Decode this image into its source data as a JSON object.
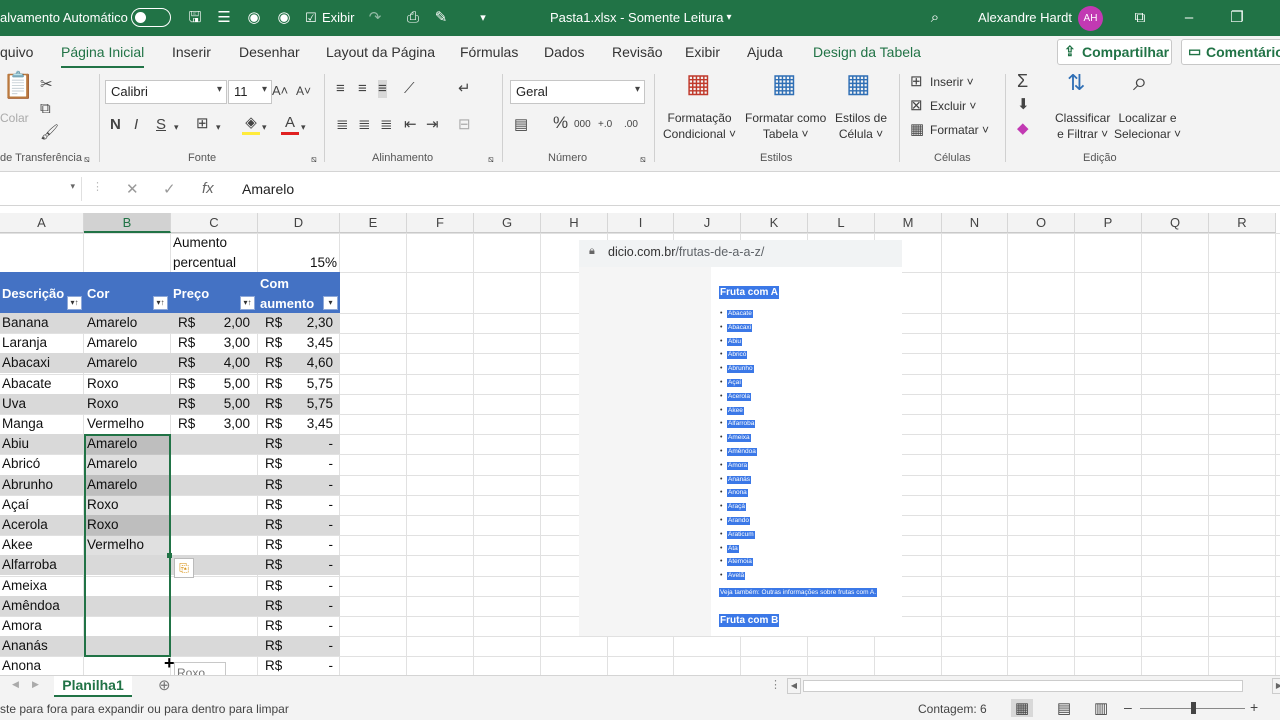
{
  "titlebar": {
    "autosave_label": "alvamento Automático",
    "view_label": "Exibir",
    "document_title": "Pasta1.xlsx  -  Somente Leitura",
    "user_name": "Alexandre Hardt",
    "user_initials": "AH"
  },
  "tabs": [
    "quivo",
    "Página Inicial",
    "Inserir",
    "Desenhar",
    "Layout da Página",
    "Fórmulas",
    "Dados",
    "Revisão",
    "Exibir",
    "Ajuda",
    "Design da Tabela"
  ],
  "share_label": "Compartilhar",
  "comments_label": "Comentário",
  "ribbon": {
    "paste_label": "Colar",
    "clipboard_group": "de Transferência",
    "font_name": "Calibri",
    "font_size": "11",
    "bold": "N",
    "italic": "I",
    "underline": "S",
    "font_group": "Fonte",
    "align_group": "Alinhamento",
    "number_format": "Geral",
    "number_group": "Número",
    "cond_format": [
      "Formatação",
      "Condicional ˅"
    ],
    "format_table": [
      "Formatar como",
      "Tabela ˅"
    ],
    "cell_styles": [
      "Estilos de",
      "Célula ˅"
    ],
    "styles_group": "Estilos",
    "insert_label": "Inserir",
    "delete_label": "Excluir",
    "format_label": "Formatar",
    "cells_group": "Células",
    "sort_label": [
      "Classificar",
      "e Filtrar ˅"
    ],
    "find_label": [
      "Localizar e",
      "Selecionar ˅"
    ],
    "edit_group": "Edição"
  },
  "formula_bar": {
    "content": "Amarelo"
  },
  "columns": [
    "A",
    "B",
    "C",
    "D",
    "E",
    "F",
    "G",
    "H",
    "I",
    "J",
    "K",
    "L",
    "M",
    "N",
    "O",
    "P",
    "Q",
    "R"
  ],
  "sheet": {
    "c1_line1": "Aumento",
    "c1_line2": "percentual",
    "d1": "15%",
    "headers": [
      "Descrição",
      "Cor",
      "Preço",
      "Com",
      "aumento"
    ],
    "rows": [
      {
        "desc": "Banana",
        "cor": "Amarelo",
        "cur1": "R$",
        "preco": "2,00",
        "cur2": "R$",
        "aumento": "2,30"
      },
      {
        "desc": "Laranja",
        "cor": "Amarelo",
        "cur1": "R$",
        "preco": "3,00",
        "cur2": "R$",
        "aumento": "3,45"
      },
      {
        "desc": "Abacaxi",
        "cor": "Amarelo",
        "cur1": "R$",
        "preco": "4,00",
        "cur2": "R$",
        "aumento": "4,60"
      },
      {
        "desc": "Abacate",
        "cor": "Roxo",
        "cur1": "R$",
        "preco": "5,00",
        "cur2": "R$",
        "aumento": "5,75"
      },
      {
        "desc": "Uva",
        "cor": "Roxo",
        "cur1": "R$",
        "preco": "5,00",
        "cur2": "R$",
        "aumento": "5,75"
      },
      {
        "desc": "Manga",
        "cor": "Vermelho",
        "cur1": "R$",
        "preco": "3,00",
        "cur2": "R$",
        "aumento": "3,45"
      },
      {
        "desc": "Abiu",
        "cor": "Amarelo",
        "cur1": "",
        "preco": "",
        "cur2": "R$",
        "aumento": "-"
      },
      {
        "desc": "Abricó",
        "cor": "Amarelo",
        "cur1": "",
        "preco": "",
        "cur2": "R$",
        "aumento": "-"
      },
      {
        "desc": "Abrunho",
        "cor": "Amarelo",
        "cur1": "",
        "preco": "",
        "cur2": "R$",
        "aumento": "-"
      },
      {
        "desc": "Açaí",
        "cor": "Roxo",
        "cur1": "",
        "preco": "",
        "cur2": "R$",
        "aumento": "-"
      },
      {
        "desc": "Acerola",
        "cor": "Roxo",
        "cur1": "",
        "preco": "",
        "cur2": "R$",
        "aumento": "-"
      },
      {
        "desc": "Akee",
        "cor": "Vermelho",
        "cur1": "",
        "preco": "",
        "cur2": "R$",
        "aumento": "-"
      },
      {
        "desc": "Alfarroba",
        "cor": "",
        "cur1": "",
        "preco": "",
        "cur2": "R$",
        "aumento": "-"
      },
      {
        "desc": "Ameixa",
        "cor": "",
        "cur1": "",
        "preco": "",
        "cur2": "R$",
        "aumento": "-"
      },
      {
        "desc": "Amêndoa",
        "cor": "",
        "cur1": "",
        "preco": "",
        "cur2": "R$",
        "aumento": "-"
      },
      {
        "desc": "Amora",
        "cor": "",
        "cur1": "",
        "preco": "",
        "cur2": "R$",
        "aumento": "-"
      },
      {
        "desc": "Ananás",
        "cor": "",
        "cur1": "",
        "preco": "",
        "cur2": "R$",
        "aumento": "-"
      },
      {
        "desc": "Anona",
        "cor": "",
        "cur1": "",
        "preco": "",
        "cur2": "R$",
        "aumento": "-"
      }
    ],
    "drag_tooltip": "Roxo"
  },
  "browser": {
    "domain": "dicio.com.br",
    "path": "/frutas-de-a-a-z/",
    "heading_a": "Fruta com A",
    "fruits": [
      "Abacate",
      "Abacaxi",
      "Abiu",
      "Abricó",
      "Abrunho",
      "Açaí",
      "Acerola",
      "Akee",
      "Alfarroba",
      "Ameixa",
      "Amêndoa",
      "Amora",
      "Ananás",
      "Anona",
      "Araçá",
      "Arando",
      "Araticum",
      "Ata",
      "Atemoia",
      "Avelã"
    ],
    "see_also": "Veja também: Outras informações sobre frutas com A.",
    "heading_b": "Fruta com B"
  },
  "sheet_tab": "Planilha1",
  "status": {
    "message": "ste para fora para expandir ou para dentro para limpar",
    "count": "Contagem: 6"
  },
  "colors": {
    "excel_green": "#217346",
    "table_header": "#4472c4",
    "band": "#d9d9d9",
    "highlight": "#3b78e7"
  }
}
